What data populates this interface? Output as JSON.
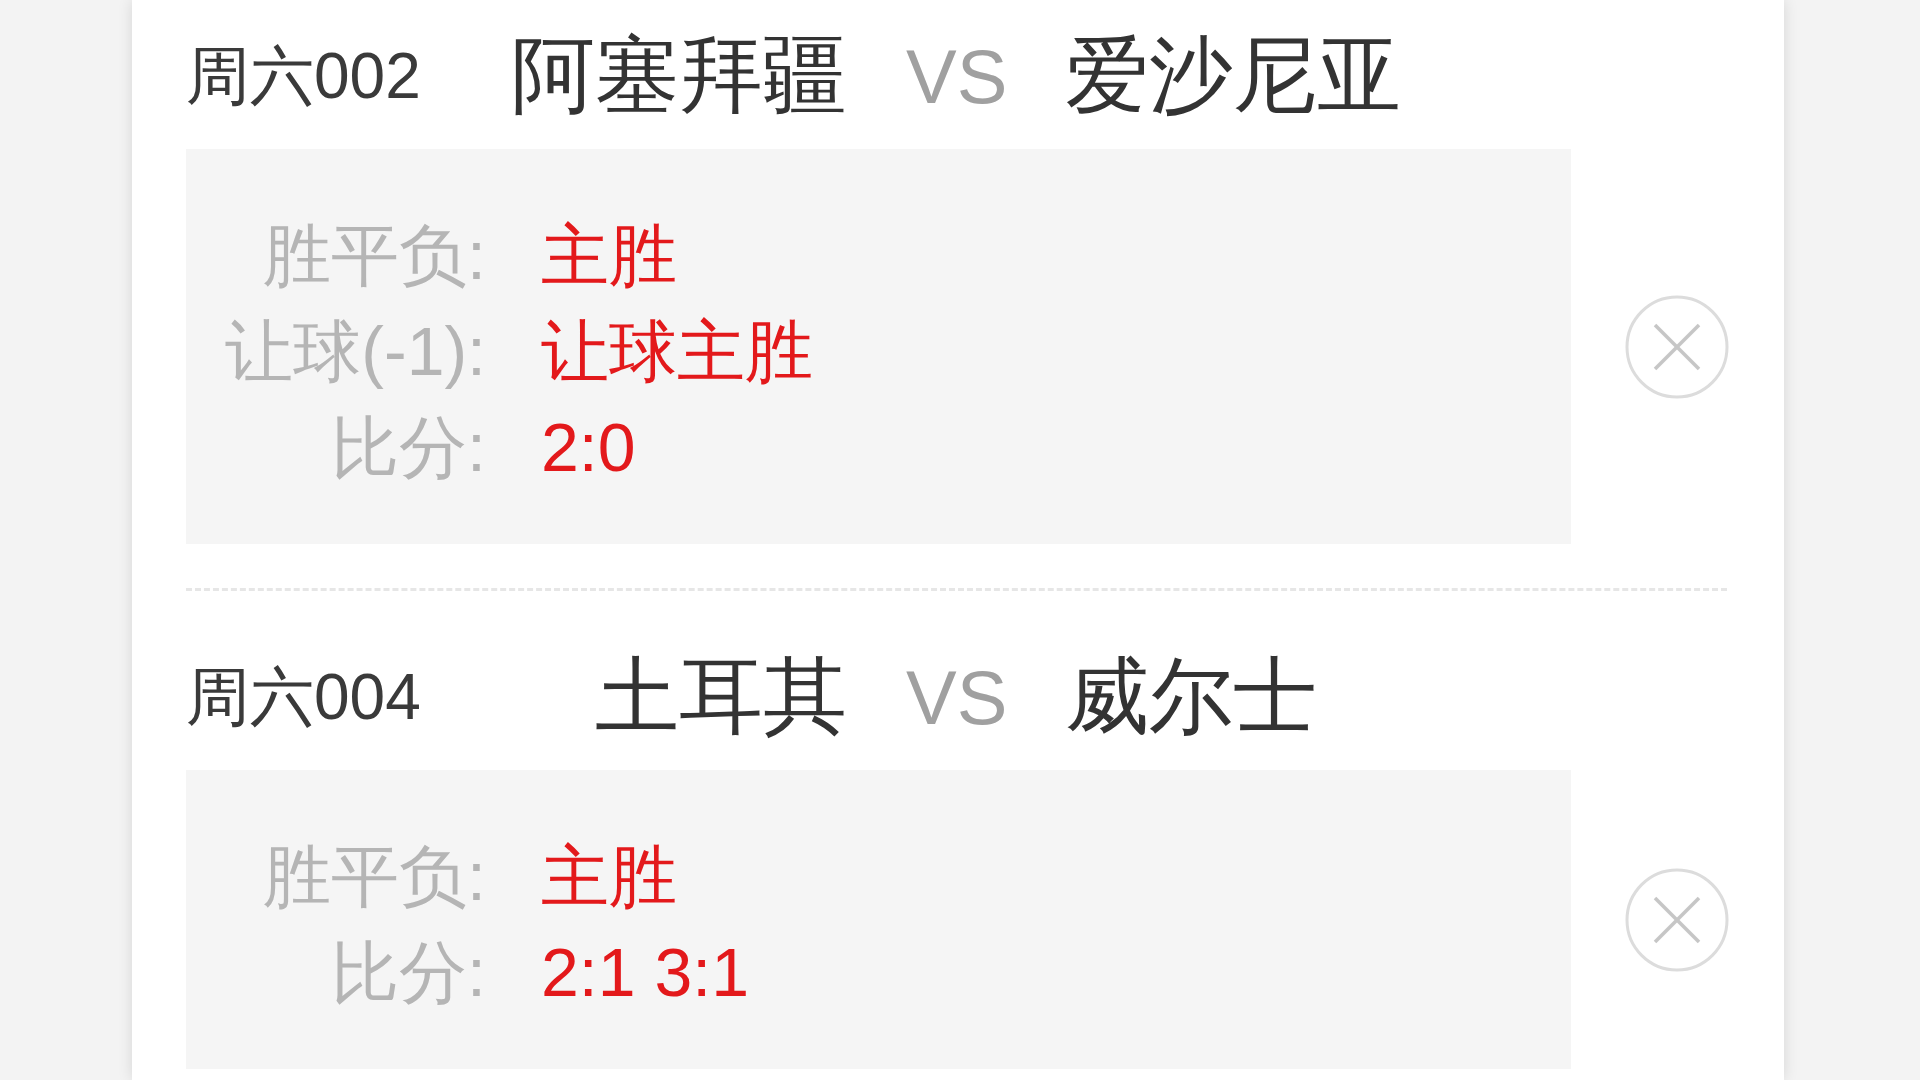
{
  "matches": [
    {
      "code": "周六002",
      "home": "阿塞拜疆",
      "vs": "VS",
      "away": "爱沙尼亚",
      "picks": [
        {
          "label": "胜平负:",
          "value": "主胜"
        },
        {
          "label": "让球(-1):",
          "value": "让球主胜"
        },
        {
          "label": "比分:",
          "value": "2:0"
        }
      ]
    },
    {
      "code": "周六004",
      "home": "土耳其",
      "vs": "VS",
      "away": "威尔士",
      "picks": [
        {
          "label": "胜平负:",
          "value": "主胜"
        },
        {
          "label": "比分:",
          "value": "2:1 3:1"
        }
      ]
    }
  ]
}
